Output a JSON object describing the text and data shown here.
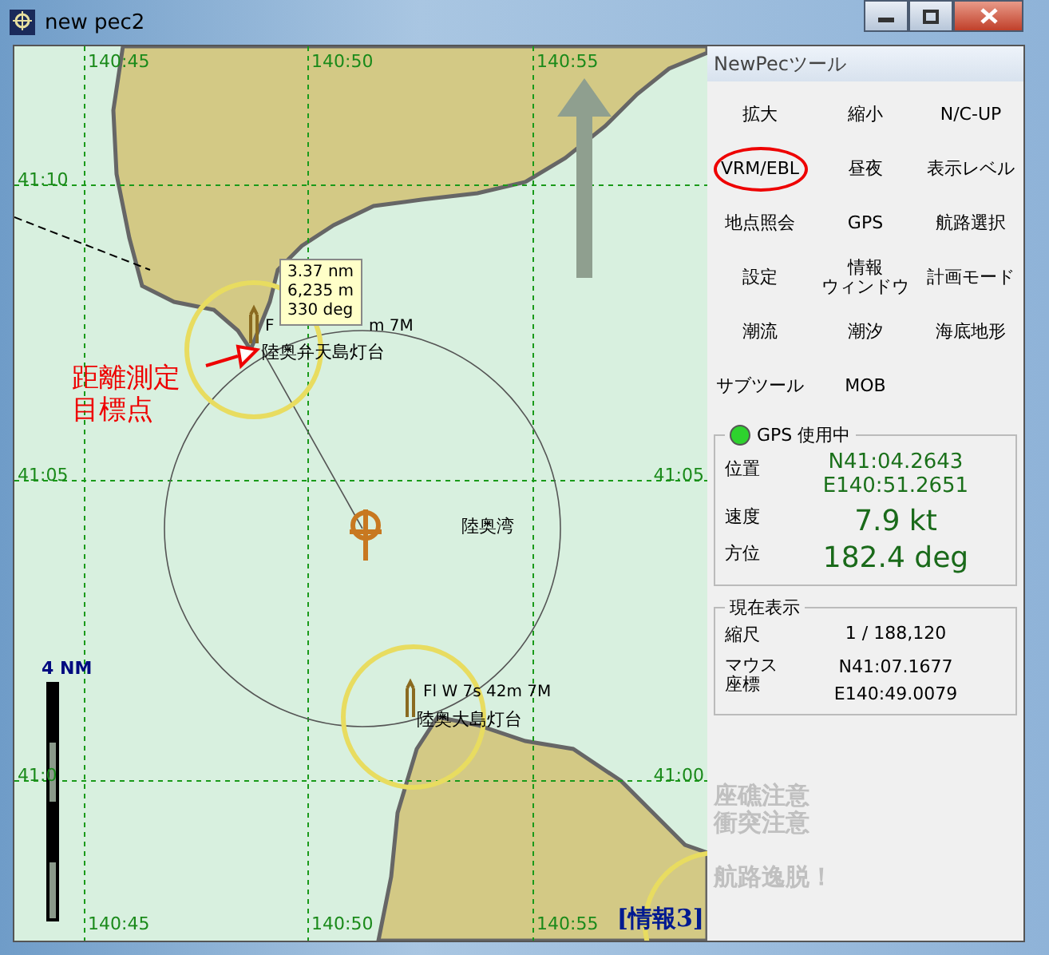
{
  "window": {
    "title": "new pec2"
  },
  "chart": {
    "top_longitudes": [
      "140:45",
      "140:50",
      "140:55"
    ],
    "bottom_longitudes": [
      "140:45",
      "140:50",
      "140:55"
    ],
    "left_latitudes": [
      "41:10",
      "41:05",
      "41:0"
    ],
    "right_latitudes": [
      "41:05",
      "41:00"
    ],
    "measurement": [
      "3.37 nm",
      "6,235 m",
      "330 deg"
    ],
    "annotation": [
      "距離測定",
      "目標点"
    ],
    "light_label_fragments": [
      "F",
      "m 7M"
    ],
    "places": [
      "陸奥弁天島灯台",
      "陸奥湾",
      "陸奥大島灯台"
    ],
    "light_label": "Fl W 7s 42m 7M",
    "scale": "4 NM",
    "info_label": "[情報3]"
  },
  "panel": {
    "title": "NewPecツール",
    "buttons": [
      {
        "label": "拡大",
        "circled": false
      },
      {
        "label": "縮小",
        "circled": false
      },
      {
        "label": "N/C-UP",
        "circled": false
      },
      {
        "label": "VRM/EBL",
        "circled": true
      },
      {
        "label": "昼夜",
        "circled": false
      },
      {
        "label": "表示レベル",
        "circled": false
      },
      {
        "label": "地点照会",
        "circled": false
      },
      {
        "label": "GPS",
        "circled": false
      },
      {
        "label": "航路選択",
        "circled": false
      },
      {
        "label": "設定",
        "circled": false
      },
      {
        "label_lines": [
          "情報",
          "ウィンドウ"
        ],
        "circled": false
      },
      {
        "label": "計画モード",
        "circled": false
      },
      {
        "label": "潮流",
        "circled": false
      },
      {
        "label": "潮汐",
        "circled": false
      },
      {
        "label": "海底地形",
        "circled": false
      },
      {
        "label": "サブツール",
        "circled": false
      },
      {
        "label": "MOB",
        "circled": false
      }
    ],
    "gps": {
      "title": "GPS 使用中",
      "on": true,
      "position_label": "位置",
      "latitude": "N41:04.2643",
      "longitude": "E140:51.2651",
      "speed_label": "速度",
      "speed": "7.9 kt",
      "heading_label": "方位",
      "heading": "182.4 deg"
    },
    "display": {
      "title": "現在表示",
      "scale_label": "縮尺",
      "scale": "1 / 188,120",
      "mouse_label": [
        "マウス",
        "座標"
      ],
      "mouse_latitude": "N41:07.1677",
      "mouse_longitude": "E140:49.0079"
    },
    "alerts": [
      {
        "text": "座礁注意",
        "active": false
      },
      {
        "text": "衝突注意",
        "active": false
      },
      {
        "text": "航路逸脱！",
        "active": false
      }
    ]
  }
}
